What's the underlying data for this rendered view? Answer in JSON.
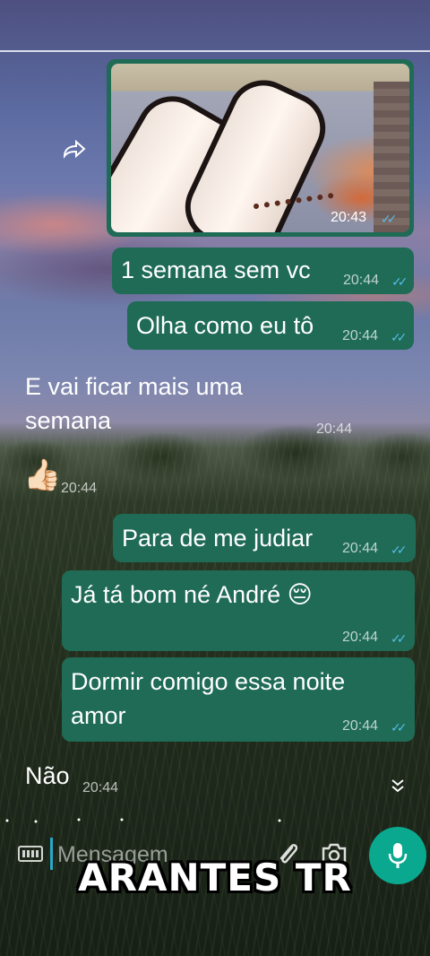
{
  "messages": [
    {
      "id": "img",
      "type": "image",
      "direction": "outgoing",
      "time": "20:43"
    },
    {
      "id": "m1",
      "direction": "outgoing",
      "text": "1 semana sem vc",
      "time": "20:44"
    },
    {
      "id": "m2",
      "direction": "outgoing",
      "text": "Olha como eu tô",
      "time": "20:44"
    },
    {
      "id": "m3",
      "direction": "incoming",
      "text_line1": "E vai ficar mais uma",
      "text_line2": "semana",
      "time": "20:44"
    },
    {
      "id": "m4",
      "direction": "incoming",
      "text": "👍🏻",
      "time": "20:44"
    },
    {
      "id": "m5",
      "direction": "outgoing",
      "text": "Para de me judiar",
      "time": "20:44"
    },
    {
      "id": "m6",
      "direction": "outgoing",
      "text": "Já tá bom né André 😔",
      "time": "20:44"
    },
    {
      "id": "m7",
      "direction": "outgoing",
      "text_line1": "Dormir comigo essa noite",
      "text_line2": "amor",
      "time": "20:44"
    },
    {
      "id": "m8",
      "direction": "incoming",
      "text": "Não",
      "time": "20:44"
    }
  ],
  "ticks": "✓✓",
  "input": {
    "placeholder": "Mensagem"
  },
  "overlay_title": "ARANTES TR",
  "icons": {
    "forward": "forward-icon",
    "keyboard": "keyboard-icon",
    "attach": "paperclip-icon",
    "camera": "camera-icon",
    "mic": "microphone-icon",
    "scroll": "double-chevron-down-icon"
  },
  "colors": {
    "bubble": "#1f6b55",
    "tick_read": "#53bdeb",
    "mic": "#0aa88e"
  }
}
